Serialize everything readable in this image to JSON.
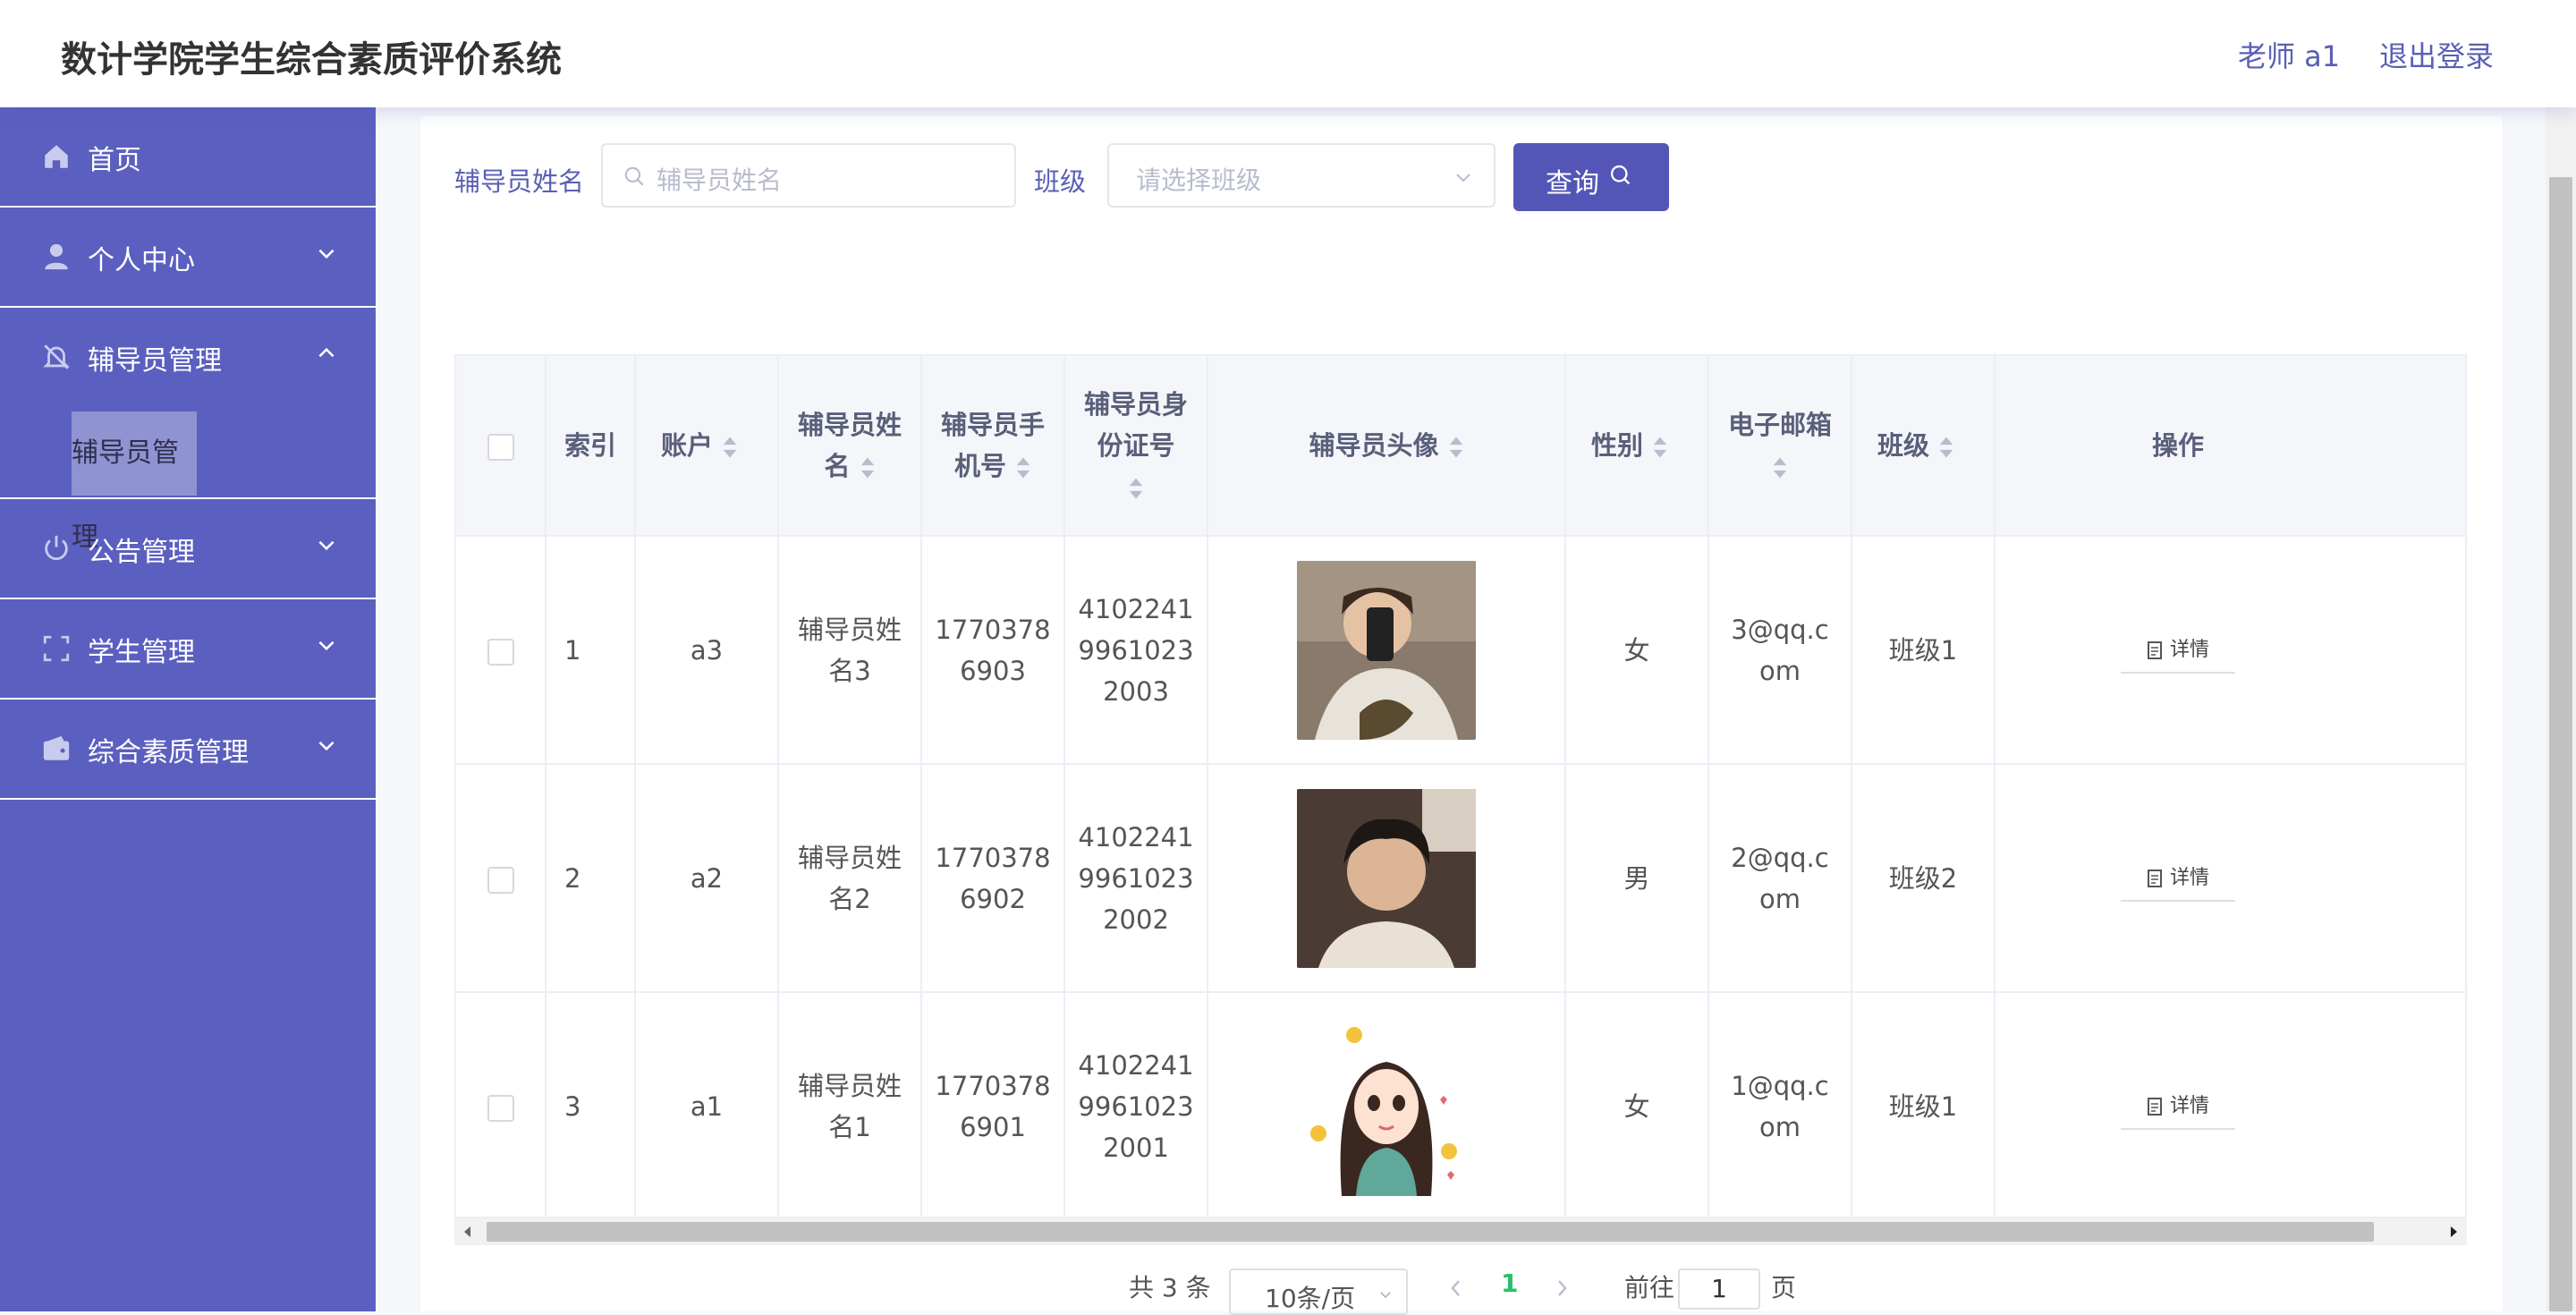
{
  "header": {
    "title": "数计学院学生综合素质评价系统",
    "user": "老师 a1",
    "logout": "退出登录"
  },
  "sidebar": {
    "items": [
      {
        "label": "首页",
        "icon": "home-icon"
      },
      {
        "label": "个人中心",
        "icon": "user-icon"
      },
      {
        "label": "辅导员管理",
        "icon": "bell-off-icon"
      },
      {
        "label": "公告管理",
        "icon": "power-icon"
      },
      {
        "label": "学生管理",
        "icon": "scan-icon"
      },
      {
        "label": "综合素质管理",
        "icon": "wallet-icon"
      }
    ],
    "sub_item": "辅导员管理"
  },
  "search": {
    "name_label": "辅导员姓名",
    "name_placeholder": "辅导员姓名",
    "class_label": "班级",
    "class_placeholder": "请选择班级",
    "query_label": "查询"
  },
  "table": {
    "headers": {
      "index": "索引",
      "account": "账户",
      "name_a": "辅导员姓",
      "name_b": "名",
      "phone_a": "辅导员手",
      "phone_b": "机号",
      "id_a": "辅导员身",
      "id_b": "份证号",
      "avatar": "辅导员头像",
      "gender": "性别",
      "email": "电子邮箱",
      "class": "班级",
      "ops": "操作"
    },
    "detail_label": "详情",
    "rows": [
      {
        "index": "1",
        "account": "a3",
        "name_a": "辅导员姓",
        "name_b": "名3",
        "phone_a": "1770378",
        "phone_b": "6903",
        "id_a": "4102241",
        "id_b": "9961023",
        "id_c": "2003",
        "gender": "女",
        "email_a": "3@qq.c",
        "email_b": "om",
        "class": "班级1"
      },
      {
        "index": "2",
        "account": "a2",
        "name_a": "辅导员姓",
        "name_b": "名2",
        "phone_a": "1770378",
        "phone_b": "6902",
        "id_a": "4102241",
        "id_b": "9961023",
        "id_c": "2002",
        "gender": "男",
        "email_a": "2@qq.c",
        "email_b": "om",
        "class": "班级2"
      },
      {
        "index": "3",
        "account": "a1",
        "name_a": "辅导员姓",
        "name_b": "名1",
        "phone_a": "1770378",
        "phone_b": "6901",
        "id_a": "4102241",
        "id_b": "9961023",
        "id_c": "2001",
        "gender": "女",
        "email_a": "1@qq.c",
        "email_b": "om",
        "class": "班级1"
      }
    ]
  },
  "pagination": {
    "total": "共 3 条",
    "page_size": "10条/页",
    "current": "1",
    "goto": "前往",
    "goto_value": "1",
    "page_suffix": "页"
  }
}
